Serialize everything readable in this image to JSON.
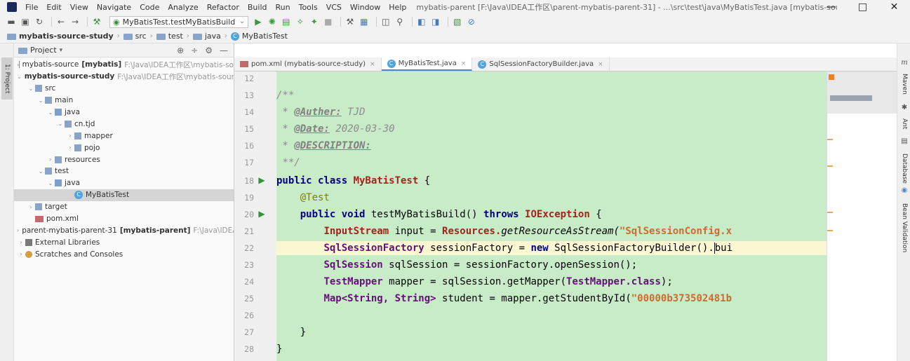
{
  "window": {
    "menu": [
      "File",
      "Edit",
      "View",
      "Navigate",
      "Code",
      "Analyze",
      "Refactor",
      "Build",
      "Run",
      "Tools",
      "VCS",
      "Window",
      "Help"
    ],
    "title": "mybatis-parent [F:\\Java\\IDEA工作区\\parent-mybatis-parent-31] - ...\\src\\test\\java\\MyBatisTest.java [mybatis-source-study]",
    "minimize": "—",
    "maximize": "□",
    "close": "✕"
  },
  "toolbar": {
    "run_config": "MyBatisTest.testMyBatisBuild"
  },
  "breadcrumb": [
    "mybatis-source-study",
    "src",
    "test",
    "java",
    "MyBatisTest"
  ],
  "project_panel": {
    "title": "Project",
    "tree": [
      {
        "label": "mybatis-source",
        "bold_suffix": "[mybatis]",
        "hint": "F:\\Java\\IDEA工作区\\mybatis-so",
        "level": 0,
        "arrow": ">",
        "icon": "module"
      },
      {
        "label": "mybatis-source-study",
        "bold": true,
        "hint": "F:\\Java\\IDEA工作区\\mybatis-sour",
        "level": 0,
        "arrow": "v",
        "icon": "module"
      },
      {
        "label": "src",
        "level": 1,
        "arrow": "v",
        "icon": "folder"
      },
      {
        "label": "main",
        "level": 2,
        "arrow": "v",
        "icon": "folder"
      },
      {
        "label": "java",
        "level": 3,
        "arrow": "v",
        "icon": "src"
      },
      {
        "label": "cn.tjd",
        "level": 4,
        "arrow": "v",
        "icon": "folder"
      },
      {
        "label": "mapper",
        "level": 5,
        "arrow": ">",
        "icon": "folder"
      },
      {
        "label": "pojo",
        "level": 5,
        "arrow": ">",
        "icon": "folder"
      },
      {
        "label": "resources",
        "level": 3,
        "arrow": ">",
        "icon": "folder"
      },
      {
        "label": "test",
        "level": 2,
        "arrow": "v",
        "icon": "folder"
      },
      {
        "label": "java",
        "level": 3,
        "arrow": "v",
        "icon": "src",
        "selected": true
      },
      {
        "label": "MyBatisTest",
        "level": 5,
        "arrow": "",
        "icon": "class",
        "selected": true
      },
      {
        "label": "target",
        "level": 1,
        "arrow": ">",
        "icon": "folder"
      },
      {
        "label": "pom.xml",
        "level": 1,
        "arrow": "",
        "icon": "xml"
      },
      {
        "label": "parent-mybatis-parent-31",
        "bold_suffix": "[mybatis-parent]",
        "hint": "F:\\Java\\IDEA",
        "level": 0,
        "arrow": ">",
        "icon": "module"
      },
      {
        "label": "External Libraries",
        "level": 0,
        "arrow": ">",
        "icon": "lib"
      },
      {
        "label": "Scratches and Consoles",
        "level": 0,
        "arrow": ">",
        "icon": "scratch"
      }
    ]
  },
  "tabs": [
    {
      "label": "pom.xml (mybatis-source-study)",
      "icon": "xml",
      "active": false
    },
    {
      "label": "MyBatisTest.java",
      "icon": "class",
      "active": true
    },
    {
      "label": "SqlSessionFactoryBuilder.java",
      "icon": "class",
      "active": false
    }
  ],
  "line_numbers": [
    "12",
    "13",
    "14",
    "15",
    "16",
    "17",
    "18",
    "19",
    "20",
    "21",
    "22",
    "23",
    "24",
    "25",
    "26",
    "27",
    "28"
  ],
  "code": {
    "l13": "/**",
    "l14_tag": "@Auther:",
    "l14_val": " TJD",
    "l15_tag": "@Date:",
    "l15_val": " 2020-03-30",
    "l16_tag": "@DESCRIPTION:",
    "l17": "**/",
    "l18_kw": "public class ",
    "l18_cls": "MyBatisTest",
    "l18_rest": " {",
    "l19": "@Test",
    "l20_kw1": "public void ",
    "l20_name": "testMyBatisBuild() ",
    "l20_kw2": "throws ",
    "l20_ex": "IOException",
    "l20_rest": " {",
    "l21_type": "InputStream",
    "l21_var": " input = ",
    "l21_cls": "Resources.",
    "l21_method": "getResourceAsStream(",
    "l21_str": "\"SqlSessionConfig.x",
    "l22_type": "SqlSessionFactory",
    "l22_var": " sessionFactory = ",
    "l22_kw": "new ",
    "l22_cls": "SqlSessionFactoryBuilder().",
    "l22_rest": "bui",
    "l23_type": "SqlSession",
    "l23_var": " sqlSession = sessionFactory.openSession();",
    "l24_type": "TestMapper",
    "l24_var": " mapper = sqlSession.getMapper(",
    "l24_cls": "TestMapper.class",
    "l24_rest": ");",
    "l25_type": "Map<String, String>",
    "l25_var": " student = mapper.getStudentById(",
    "l25_str": "\"00000b373502481b",
    "l27": "}",
    "l28": "}"
  },
  "right_tools": [
    "Maven",
    "Ant",
    "Database",
    "Bean Validation"
  ],
  "right_glyph": "m",
  "colors": {
    "editor_bg": "#c8ebc8",
    "current_line": "#fbf7d2",
    "keyword": "#000080",
    "class": "#a0261b",
    "string": "#cc6b2d"
  }
}
